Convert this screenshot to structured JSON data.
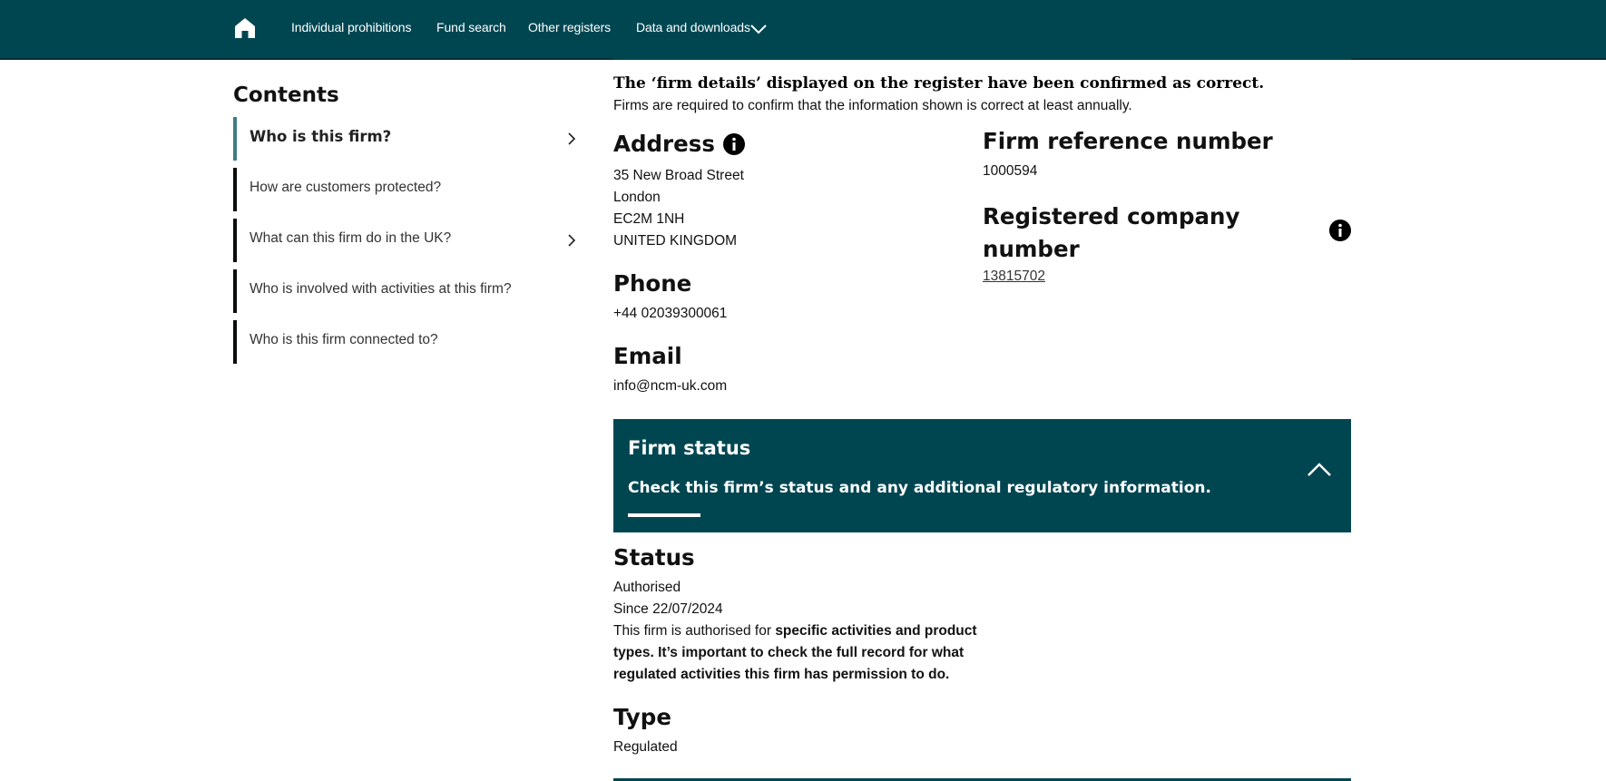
{
  "nav": {
    "home_icon": "home-icon",
    "links": [
      "Individual prohibitions",
      "Fund search",
      "Other registers",
      "Data and downloads"
    ],
    "dropdown_icon": "chevron-down-icon"
  },
  "sidebar": {
    "title": "Contents",
    "items": [
      {
        "label": "Who is this firm?",
        "active": true,
        "has_chevron": true
      },
      {
        "label": "How are customers protected?",
        "active": false,
        "has_chevron": false
      },
      {
        "label": "What can this firm do in the UK?",
        "active": false,
        "has_chevron": true
      },
      {
        "label": "Who is involved with activities at this firm?",
        "active": false,
        "has_chevron": false
      },
      {
        "label": "Who is this firm connected to?",
        "active": false,
        "has_chevron": false
      }
    ]
  },
  "confirmation": {
    "heading": "The ‘firm details’ displayed on the register have been confirmed as correct.",
    "text": "Firms are required to confirm that the information shown is correct at least annually."
  },
  "address": {
    "heading": "Address",
    "lines": [
      "35 New Broad Street",
      "London",
      "EC2M 1NH",
      "UNITED KINGDOM"
    ]
  },
  "phone": {
    "heading": "Phone",
    "value": "+44 02039300061"
  },
  "email": {
    "heading": "Email",
    "value": "info@ncm-uk.com"
  },
  "frn": {
    "heading": "Firm reference number",
    "value": "1000594"
  },
  "company_number": {
    "heading_line1": "Registered company",
    "heading_line2": "number",
    "value": "13815702"
  },
  "firm_status_panel": {
    "title": "Firm status",
    "subtitle": "Check this firm’s status and any additional regulatory information.",
    "expanded": true
  },
  "status": {
    "heading": "Status",
    "value": "Authorised",
    "since": "Since 22/07/2024",
    "note_prefix": "This firm is authorised for ",
    "note_bold_1": "specific activities and product",
    "note_bold_2": "types. It’s important to check the full record for what",
    "note_bold_3": "regulated activities this firm has permission to do."
  },
  "type": {
    "heading": "Type",
    "value": "Regulated"
  },
  "colors": {
    "primary": "#004651",
    "active_marker": "#3f7c85",
    "text": "#1a1a1a"
  }
}
